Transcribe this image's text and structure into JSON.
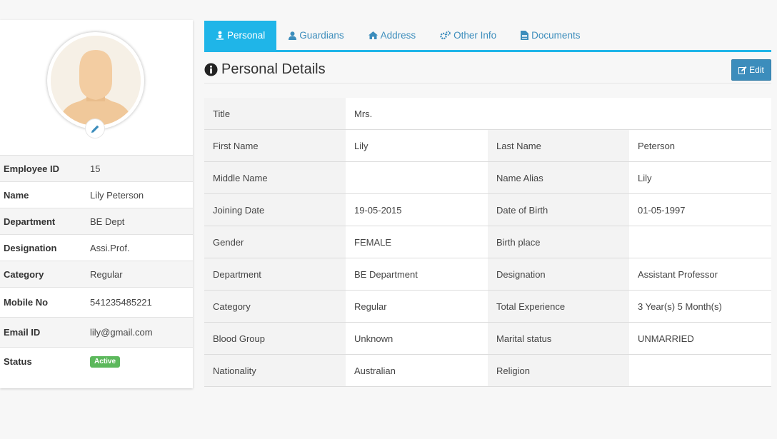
{
  "profile": {
    "fields": [
      {
        "label": "Employee ID",
        "value": "15"
      },
      {
        "label": "Name",
        "value": "Lily Peterson"
      },
      {
        "label": "Department",
        "value": "BE Dept"
      },
      {
        "label": "Designation",
        "value": "Assi.Prof."
      },
      {
        "label": "Category",
        "value": "Regular"
      },
      {
        "label": "Mobile No",
        "value": "541235485221"
      },
      {
        "label": "Email ID",
        "value": "lily@gmail.com"
      },
      {
        "label": "Status",
        "value": "Active"
      }
    ],
    "status_color": "#5cb85c"
  },
  "tabs": [
    {
      "label": "Personal",
      "icon": "person-icon",
      "active": true
    },
    {
      "label": "Guardians",
      "icon": "user-icon",
      "active": false
    },
    {
      "label": "Address",
      "icon": "home-icon",
      "active": false
    },
    {
      "label": "Other Info",
      "icon": "gears-icon",
      "active": false
    },
    {
      "label": "Documents",
      "icon": "document-icon",
      "active": false
    }
  ],
  "section": {
    "title": "Personal Details",
    "icon": "info-circle-icon",
    "edit_label": "Edit"
  },
  "details": {
    "title": {
      "label": "Title",
      "value": "Mrs."
    },
    "rows": [
      [
        {
          "label": "First Name",
          "value": "Lily"
        },
        {
          "label": "Last Name",
          "value": "Peterson"
        }
      ],
      [
        {
          "label": "Middle Name",
          "value": ""
        },
        {
          "label": "Name Alias",
          "value": "Lily"
        }
      ],
      [
        {
          "label": "Joining Date",
          "value": "19-05-2015"
        },
        {
          "label": "Date of Birth",
          "value": "01-05-1997"
        }
      ],
      [
        {
          "label": "Gender",
          "value": "FEMALE"
        },
        {
          "label": "Birth place",
          "value": ""
        }
      ],
      [
        {
          "label": "Department",
          "value": "BE Department"
        },
        {
          "label": "Designation",
          "value": "Assistant Professor"
        }
      ],
      [
        {
          "label": "Category",
          "value": "Regular"
        },
        {
          "label": "Total Experience",
          "value": "3 Year(s) 5 Month(s)"
        }
      ],
      [
        {
          "label": "Blood Group",
          "value": "Unknown"
        },
        {
          "label": "Marital status",
          "value": "UNMARRIED"
        }
      ],
      [
        {
          "label": "Nationality",
          "value": "Australian"
        },
        {
          "label": "Religion",
          "value": ""
        }
      ]
    ]
  },
  "colors": {
    "accent": "#1fb5e8",
    "primary": "#3c8dbc"
  }
}
